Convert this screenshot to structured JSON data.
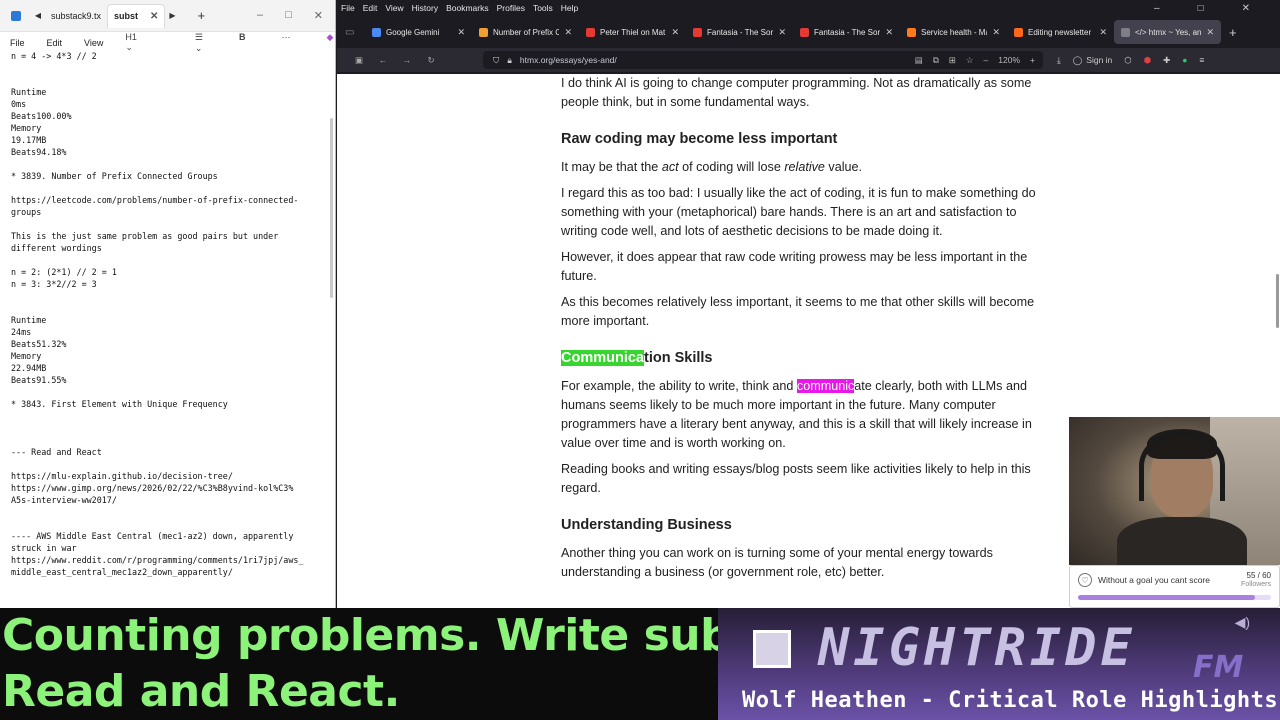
{
  "editor": {
    "tab_title": "substack9.tx",
    "tab_active": "subst",
    "menu": [
      "File",
      "Edit",
      "View"
    ],
    "heading_select": "H1",
    "bold": "B",
    "lines": [
      "n = 4 -> 4*3 // 2",
      "",
      "",
      "Runtime",
      "0ms",
      "Beats100.00%",
      "Memory",
      "19.17MB",
      "Beats94.18%",
      "",
      "* 3839. Number of Prefix Connected Groups",
      "",
      "https://leetcode.com/problems/number-of-prefix-connected-",
      "groups",
      "",
      "This is the just same problem as good pairs but under",
      "different wordings",
      "",
      "n = 2: (2*1) // 2 = 1",
      "n = 3: 3*2//2 = 3",
      "",
      "",
      "Runtime",
      "24ms",
      "Beats51.32%",
      "Memory",
      "22.94MB",
      "Beats91.55%",
      "",
      "* 3843. First Element with Unique Frequency",
      "",
      "",
      "",
      "--- Read and React",
      "",
      "https://mlu-explain.github.io/decision-tree/",
      "https://www.gimp.org/news/2026/02/22/%C3%B8yvind-kol%C3%",
      "A5s-interview-ww2017/",
      "",
      "",
      "---- AWS Middle East Central (mec1-az2) down, apparently",
      "struck in war",
      "https://www.reddit.com/r/programming/comments/1ri7jpj/aws_",
      "middle_east_central_mec1az2_down_apparently/"
    ]
  },
  "browser": {
    "menu": [
      "File",
      "Edit",
      "View",
      "History",
      "Bookmarks",
      "Profiles",
      "Tools",
      "Help"
    ],
    "tabs": [
      {
        "label": "Google Gemini",
        "color": "#4a8af4"
      },
      {
        "label": "Number of Prefix C",
        "color": "#f0a030"
      },
      {
        "label": "Peter Thiel on Mat",
        "color": "#e53935"
      },
      {
        "label": "Fantasia - The Sorc",
        "color": "#e53935"
      },
      {
        "label": "Fantasia - The Sorc",
        "color": "#e53935"
      },
      {
        "label": "Service health - Ma",
        "color": "#ff7a1a"
      },
      {
        "label": "Editing newsletter",
        "color": "#ff6719"
      },
      {
        "label": "</> htmx ~ Yes, an",
        "color": "#7f7f8a"
      }
    ],
    "url": "htmx.org/essays/yes-and/",
    "zoom": "120%",
    "sign_in": "Sign in"
  },
  "article": {
    "intro": "I do think AI is going to change computer programming. Not as dramatically as some people think, but in some fundamental ways.",
    "h_raw": "Raw coding may become less important",
    "p_act_before": "It may be that the ",
    "p_act_em": "act",
    "p_act_mid": " of coding will lose ",
    "p_act_em2": "relative",
    "p_act_after": " value.",
    "p_regard": "I regard this as too bad: I usually like the act of coding, it is fun to make something do something with your (metaphorical) bare hands. There is an art and satisfaction to writing code well, and lots of aesthetic decisions to be made doing it.",
    "p_however": "However, it does appear that raw code writing prowess may be less important in the future.",
    "p_asthis": "As this becomes relatively less important, it seems to me that other skills will become more important.",
    "h_comm_hl": "Communica",
    "h_comm_rest": "tion Skills",
    "p_comm_before": "For example, the ability to write, think and ",
    "p_comm_hl": "communic",
    "p_comm_after": "ate clearly, both with LLMs and humans seems likely to be much more important in the future. Many computer programmers have a literary bent anyway, and this is a skill that will likely increase in value over time and is worth working on.",
    "p_reading": "Reading books and writing essays/blog posts seem like activities likely to help in this regard.",
    "h_business": "Understanding Business",
    "p_business": "Another thing you can work on is turning some of your mental energy towards understanding a business (or government role, etc) better."
  },
  "widget": {
    "goal_text": "Without a goal you cant score",
    "count": "55 / 60",
    "count_label": "Followers",
    "progress": 0.9167
  },
  "overlay": {
    "marquee_line1": "Counting problems. Write subs",
    "marquee_line2": "Read and React.",
    "station": "NIGHTRIDE",
    "station_fm": "FM",
    "now_playing": "Wolf Heathen - Critical Role Highlights"
  }
}
